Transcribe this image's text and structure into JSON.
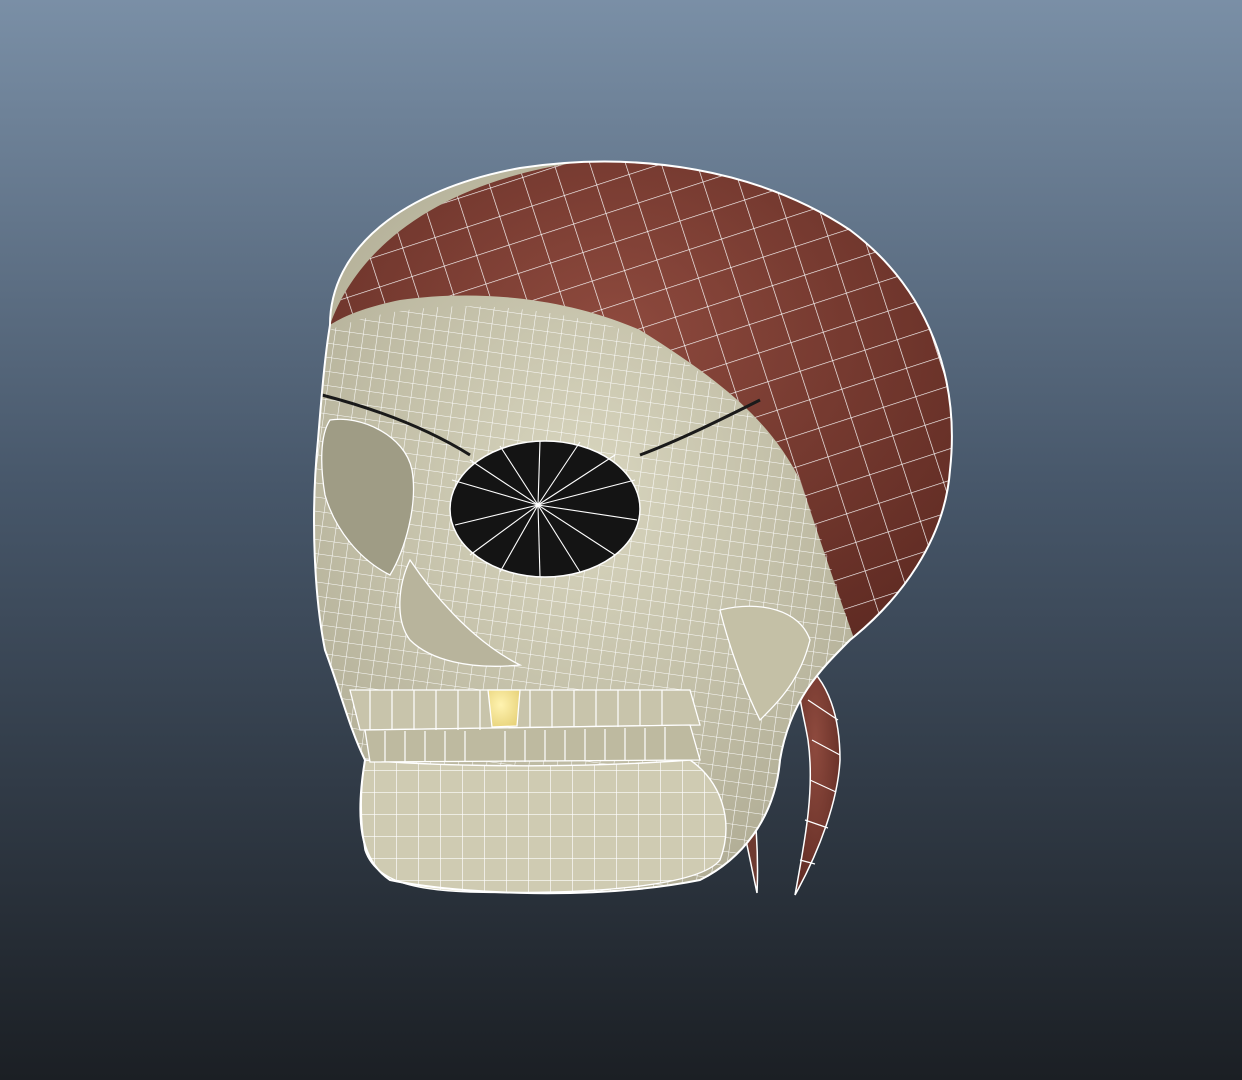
{
  "viewport": {
    "background_top": "#7A8FA6",
    "background_mid": "#47576A",
    "background_bottom": "#1B1F24"
  },
  "model": {
    "subject": "pirate-skull-icon",
    "display_mode": "wireframe-on-shaded",
    "colors": {
      "bone": "#D9D6BF",
      "bone_shadow": "#A8A48C",
      "bandana": "#8E4A3E",
      "bandana_shadow": "#5E2A22",
      "eye_patch": "#141414",
      "gold_tooth": "#E7D27A",
      "wire": "#FFFFFF"
    }
  }
}
